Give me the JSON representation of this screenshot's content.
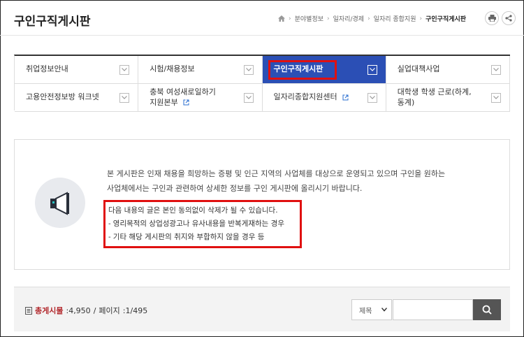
{
  "page_title": "구인구직게시판",
  "breadcrumb": {
    "items": [
      "분야별정보",
      "일자리/경제",
      "일자리 종합지원"
    ],
    "current": "구인구직게시판"
  },
  "header_buttons": {
    "print": "print-icon",
    "share": "share-icon"
  },
  "menu": [
    {
      "label": "취업정보안내",
      "active": false,
      "external": false
    },
    {
      "label": "시험/채용정보",
      "active": false,
      "external": false
    },
    {
      "label": "구인구직게시판",
      "active": true,
      "external": false
    },
    {
      "label": "실업대책사업",
      "active": false,
      "external": false
    },
    {
      "label": "고용안전정보방 워크넷",
      "active": false,
      "external": false
    },
    {
      "label_line1": "충북 여성새로일하기",
      "label_line2": "지원본부",
      "active": false,
      "external": true
    },
    {
      "label": "일자리종합지원센터",
      "active": false,
      "external": true
    },
    {
      "label_line1": "대학생 학생 근로(하계,",
      "label_line2": "동계)",
      "active": false,
      "external": false
    }
  ],
  "notice": {
    "line1": "본 게시판은 인재 채용을 희망하는 증평 및 인근 지역의 사업체를 대상으로 운영되고 있으며 구인을 원하는",
    "line2": "사업체에서는 구인과 관련하여 상세한 정보를 구인 게시판에 올리시기 바랍니다.",
    "warning_title": "다음 내용의 글은 본인 동의없이 삭제가 될 수 있습니다.",
    "warning_items": [
      "영리목적의 상업성광고나 유사내용을 반복게재하는 경우",
      "기타 해당 게시판의 취지와 부합하지 않을 경우 등"
    ]
  },
  "list_info": {
    "total_label": "총게시물",
    "total_value": ":4,950",
    "page_label": "페이지",
    "page_value": ":1/495"
  },
  "search": {
    "select_value": "제목",
    "input_value": ""
  },
  "colors": {
    "active_menu": "#2b4fb5",
    "highlight": "#e01010",
    "total_label": "#b2282c"
  }
}
